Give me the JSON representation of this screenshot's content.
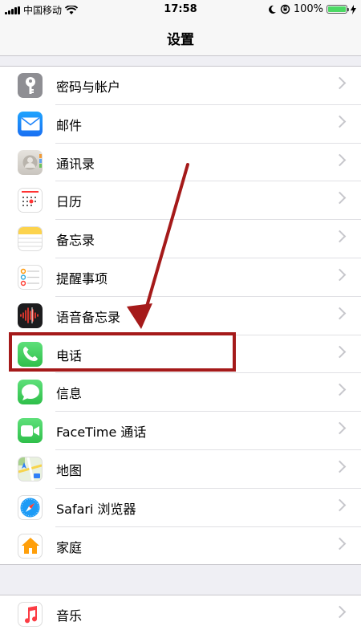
{
  "status_bar": {
    "carrier": "中国移动",
    "time": "17:58",
    "battery": "100%",
    "battery_level": 1.0
  },
  "nav": {
    "title": "设置"
  },
  "settings": [
    {
      "label": "密码与帐户",
      "icon": "key-icon",
      "color": "#8e8e93"
    },
    {
      "label": "邮件",
      "icon": "mail-icon",
      "color": "#1a82fb"
    },
    {
      "label": "通讯录",
      "icon": "contacts-icon",
      "color": "#d8d5d0"
    },
    {
      "label": "日历",
      "icon": "calendar-icon",
      "color": "#ffffff"
    },
    {
      "label": "备忘录",
      "icon": "notes-icon",
      "color": "#ffffff"
    },
    {
      "label": "提醒事项",
      "icon": "reminders-icon",
      "color": "#ffffff"
    },
    {
      "label": "语音备忘录",
      "icon": "voice-memos-icon",
      "color": "#1c1c1e"
    },
    {
      "label": "电话",
      "icon": "phone-icon",
      "color": "#34c759"
    },
    {
      "label": "信息",
      "icon": "messages-icon",
      "color": "#34c759"
    },
    {
      "label": "FaceTime 通话",
      "icon": "facetime-icon",
      "color": "#34c759"
    },
    {
      "label": "地图",
      "icon": "maps-icon",
      "color": "#e9f1df"
    },
    {
      "label": "Safari 浏览器",
      "icon": "safari-icon",
      "color": "#ffffff"
    },
    {
      "label": "家庭",
      "icon": "home-icon",
      "color": "#ffffff"
    }
  ],
  "settings_group2": [
    {
      "label": "音乐",
      "icon": "music-icon",
      "color": "#ffffff"
    }
  ],
  "annotation": {
    "highlight_color": "#a51a1a",
    "highlighted_item": "电话"
  }
}
